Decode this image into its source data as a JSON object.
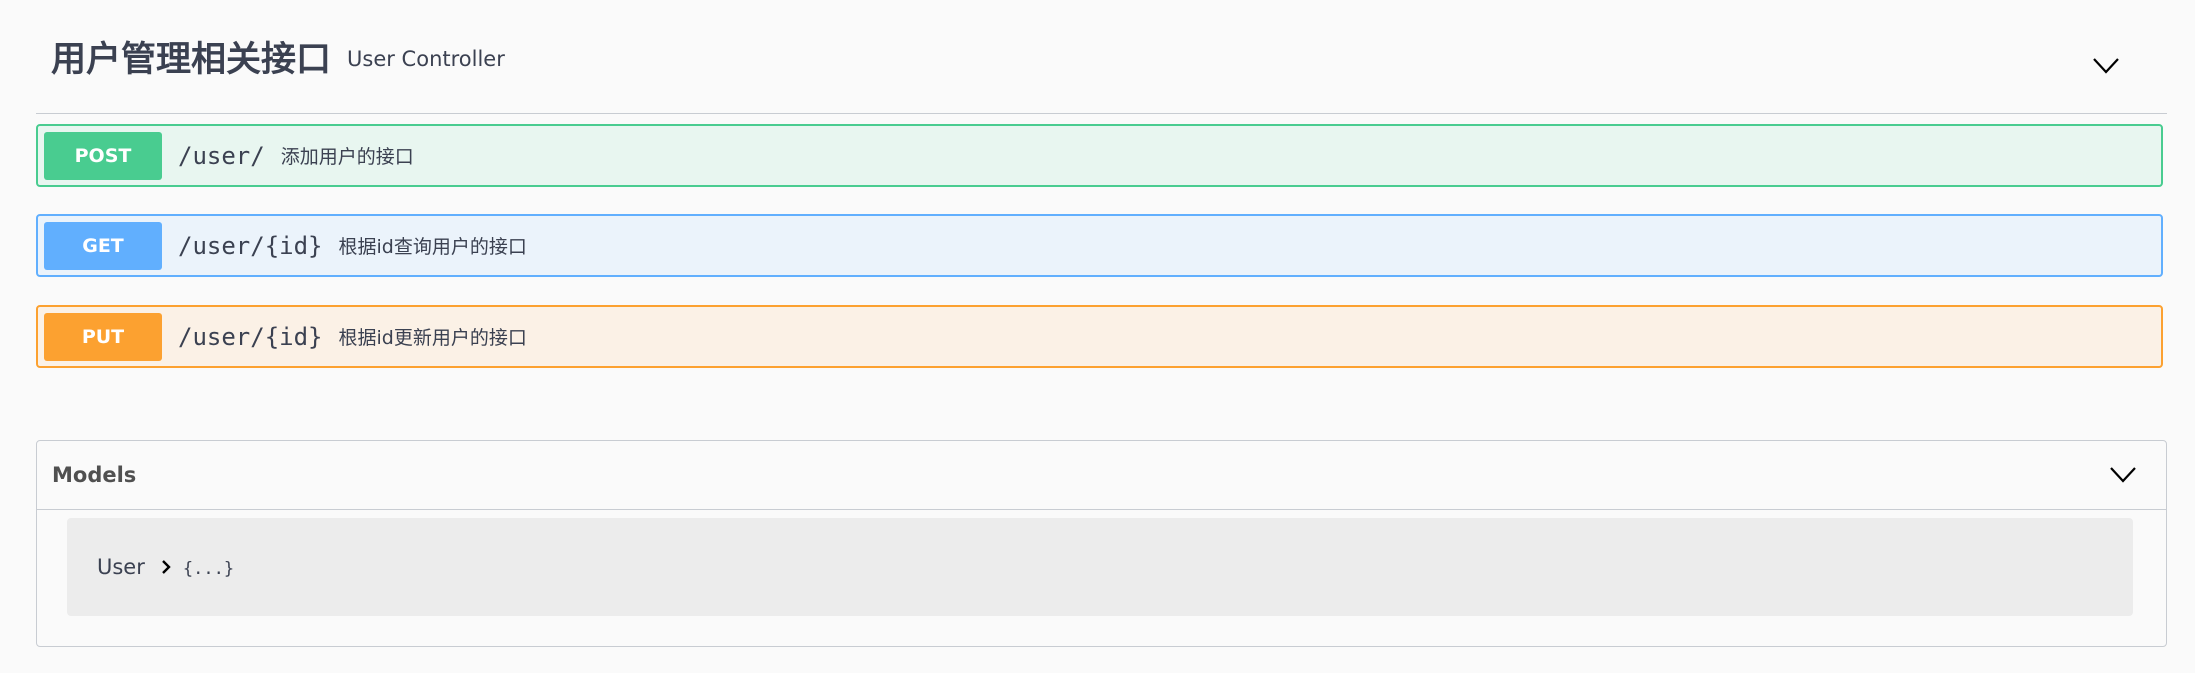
{
  "tag": {
    "title": "用户管理相关接口",
    "description": "User Controller",
    "toggle_icon": "chevron-down-icon"
  },
  "operations": [
    {
      "method": "POST",
      "path": "/user/",
      "summary": "添加用户的接口",
      "color": "#49cc90"
    },
    {
      "method": "GET",
      "path": "/user/{id}",
      "summary": "根据id查询用户的接口",
      "color": "#61affe"
    },
    {
      "method": "PUT",
      "path": "/user/{id}",
      "summary": "根据id更新用户的接口",
      "color": "#fca130"
    }
  ],
  "models": {
    "title": "Models",
    "toggle_icon": "chevron-down-icon",
    "items": [
      {
        "name": "User",
        "expand_icon": "chevron-right-icon",
        "collapsed_text": "{...}"
      }
    ]
  }
}
